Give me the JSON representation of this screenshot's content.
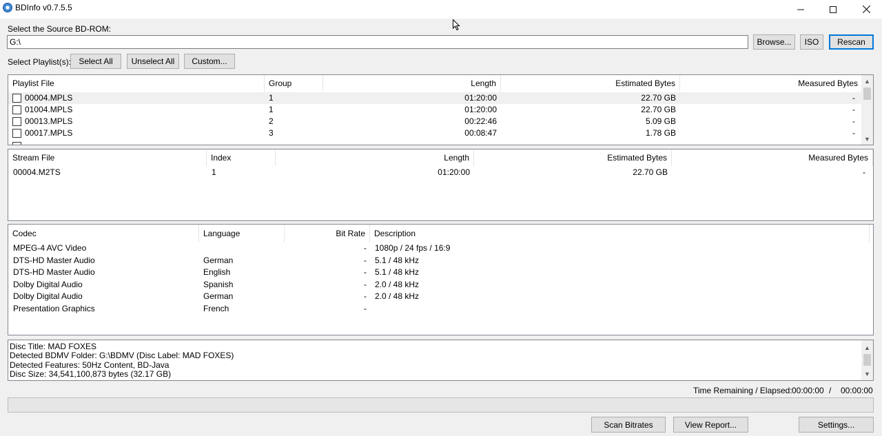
{
  "window": {
    "title": "BDInfo v0.7.5.5"
  },
  "source": {
    "label": "Select the Source BD-ROM:",
    "path": "G:\\",
    "browse": "Browse...",
    "iso": "ISO",
    "rescan": "Rescan"
  },
  "playlist_select": {
    "label": "Select Playlist(s):",
    "select_all": "Select All",
    "unselect_all": "Unselect All",
    "custom": "Custom..."
  },
  "playlists": {
    "headers": [
      "Playlist File",
      "Group",
      "Length",
      "Estimated Bytes",
      "Measured Bytes"
    ],
    "rows": [
      {
        "file": "00004.MPLS",
        "group": "1",
        "length": "01:20:00",
        "est": "22.70 GB",
        "meas": "-"
      },
      {
        "file": "01004.MPLS",
        "group": "1",
        "length": "01:20:00",
        "est": "22.70 GB",
        "meas": "-"
      },
      {
        "file": "00013.MPLS",
        "group": "2",
        "length": "00:22:46",
        "est": "5.09 GB",
        "meas": "-"
      },
      {
        "file": "00017.MPLS",
        "group": "3",
        "length": "00:08:47",
        "est": "1.78 GB",
        "meas": "-"
      }
    ]
  },
  "streams": {
    "headers": [
      "Stream File",
      "Index",
      "Length",
      "Estimated Bytes",
      "Measured Bytes"
    ],
    "rows": [
      {
        "file": "00004.M2TS",
        "index": "1",
        "length": "01:20:00",
        "est": "22.70 GB",
        "meas": "-"
      }
    ]
  },
  "codecs": {
    "headers": [
      "Codec",
      "Language",
      "Bit Rate",
      "Description"
    ],
    "rows": [
      {
        "codec": "MPEG-4 AVC Video",
        "lang": "",
        "bitrate": "-",
        "desc": "1080p / 24 fps / 16:9"
      },
      {
        "codec": "DTS-HD Master Audio",
        "lang": "German",
        "bitrate": "-",
        "desc": "5.1 / 48 kHz"
      },
      {
        "codec": "DTS-HD Master Audio",
        "lang": "English",
        "bitrate": "-",
        "desc": "5.1 / 48 kHz"
      },
      {
        "codec": "Dolby Digital Audio",
        "lang": "Spanish",
        "bitrate": "-",
        "desc": "2.0 / 48 kHz"
      },
      {
        "codec": "Dolby Digital Audio",
        "lang": "German",
        "bitrate": "-",
        "desc": "2.0 / 48 kHz"
      },
      {
        "codec": "Presentation Graphics",
        "lang": "French",
        "bitrate": "-",
        "desc": ""
      }
    ]
  },
  "disc_info": [
    "Disc Title: MAD FOXES",
    "Detected BDMV Folder: G:\\BDMV (Disc Label: MAD FOXES)",
    "Detected Features: 50Hz Content, BD-Java",
    "Disc Size: 34,541,100,873 bytes (32.17 GB)"
  ],
  "timer": {
    "label": "Time Remaining / Elapsed:",
    "remaining": "00:00:00",
    "separator": "/",
    "elapsed": "00:00:00"
  },
  "progress": 0,
  "buttons": {
    "scan_bitrates": "Scan Bitrates",
    "view_report": "View Report...",
    "settings": "Settings..."
  }
}
